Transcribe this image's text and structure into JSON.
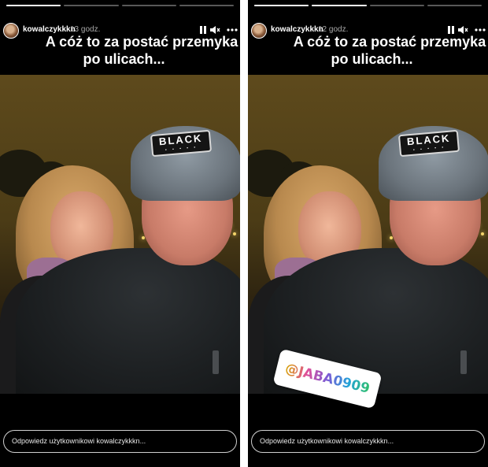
{
  "stories": [
    {
      "username": "kowalczykkkn",
      "time": "13 godz.",
      "caption_line1": "A cóż to za postać przemyka",
      "caption_line2": "po ulicach...",
      "patch_text": "BLACK",
      "patch_subtext": "• • • • •",
      "reply_placeholder": "Odpowiedz użytkownikowi kowalczykkkn...",
      "progress": [
        1,
        0,
        0,
        0
      ]
    },
    {
      "username": "kowalczykkkn",
      "time": "12 godz.",
      "caption_line1": "A cóż to za postać przemyka",
      "caption_line2": "po ulicach...",
      "patch_text": "BLACK",
      "patch_subtext": "• • • • •",
      "mention_sticker": "@JABA0909",
      "reply_placeholder": "Odpowiedz użytkownikowi kowalczykkkn...",
      "progress": [
        1,
        1,
        0,
        0
      ]
    }
  ],
  "icons": {
    "pause": "pause-icon",
    "mute": "speaker-muted-icon",
    "more": "more-horizontal-icon"
  }
}
